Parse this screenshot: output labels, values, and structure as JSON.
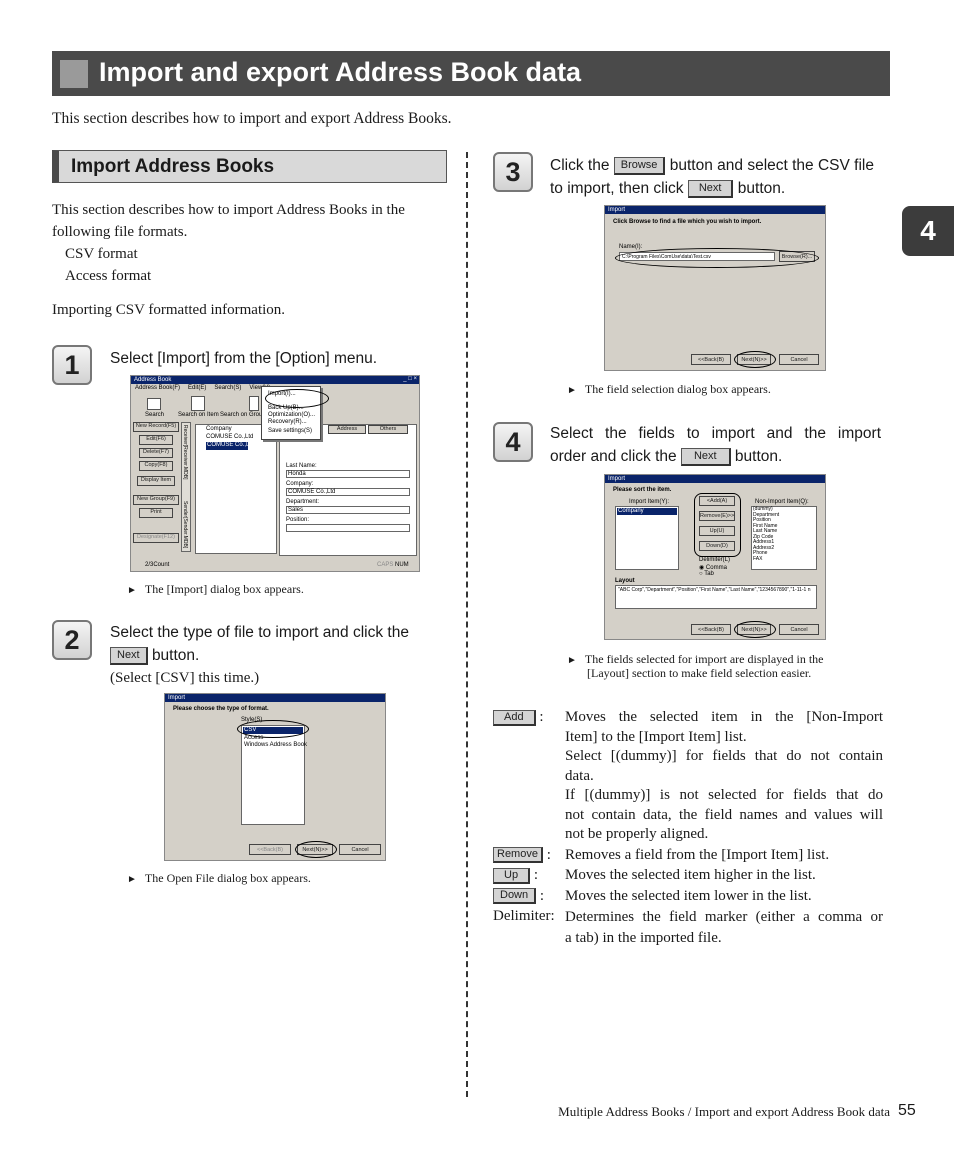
{
  "title": "Import and export Address Book data",
  "intro": "This section describes how to import and export Address Books.",
  "subheading": "Import Address Books",
  "body": {
    "line1": "This section describes how to import Address Books in the",
    "line2": "following file formats.",
    "formats": [
      "CSV format",
      "Access format"
    ],
    "csv_note": "Importing CSV formatted information."
  },
  "steps": [
    {
      "num": "1",
      "text": "Select [Import] from the [Option] menu.",
      "result": "The [Import] dialog box appears."
    },
    {
      "num": "2",
      "text_a": "Select the type of file to import and click the",
      "button": "Next",
      "text_b": "button.",
      "note": "(Select [CSV] this time.)",
      "result": "The Open File dialog box appears."
    },
    {
      "num": "3",
      "text_a": "Click the",
      "button1": "Browse",
      "text_b": "button and select the CSV file",
      "text_c": "to import, then click",
      "button2": "Next",
      "text_d": "button.",
      "result": "The field selection dialog box appears."
    },
    {
      "num": "4",
      "text_a": "Select the fields to import and the import",
      "text_b": "order and click the",
      "button": "Next",
      "text_c": "button.",
      "result_1": "The fields selected for import are displayed in the",
      "result_2": "[Layout] section to make field selection easier."
    }
  ],
  "definitions": [
    {
      "term": "Add",
      "lines": [
        "Moves the selected item in the [Non-Import",
        "Item] to the [Import Item] list.",
        "Select [(dummy)] for fields that do not contain",
        "data.",
        "If [(dummy)] is not selected for fields that do",
        "not contain data, the field names and values will",
        "not be properly aligned."
      ]
    },
    {
      "term": "Remove",
      "lines": [
        "Removes a field from the [Import Item] list."
      ]
    },
    {
      "term": "Up",
      "lines": [
        "Moves the selected item higher in the list."
      ]
    },
    {
      "term": "Down",
      "lines": [
        "Moves the selected item lower in the list."
      ]
    },
    {
      "term": "Delimiter:",
      "lines": [
        "Determines the field marker (either a comma or",
        "a tab) in the imported file."
      ]
    }
  ],
  "chapter_tab": "4",
  "footer": "Multiple Address Books / Import and export Address Book data",
  "page_number": "55",
  "screens": {
    "s1": {
      "title": "Address Book",
      "menu": [
        "Address Book(F)",
        "Edit(E)",
        "Search(S)",
        "View(V)"
      ],
      "toolbar": [
        "Search",
        "Search on Item",
        "Search on Group"
      ],
      "option_menu": [
        "Import(I)...",
        "Back Up(B)...",
        "Optimization(O)...",
        "Recovery(R)...",
        "Save settings(S)"
      ],
      "left_buttons": [
        "New Record(F5)",
        "Edit(F6)",
        "Delete(F7)",
        "Copy(F8)",
        "Display Item",
        "New Group(F9)",
        "Print",
        "Designate(F12)"
      ],
      "rows": [
        "COMUSE Co.,Ltd",
        "COMUSE Co.,Ltd"
      ],
      "col_header": "Company",
      "tabs": [
        "Address",
        "Others"
      ],
      "fields": [
        "Last Name:",
        "Company:",
        "Department:",
        "Position:"
      ],
      "values": [
        "Honda",
        "COMUSE Co.,Ltd",
        "Sales"
      ],
      "status": [
        "2/3Count",
        "CAPS",
        "NUM"
      ],
      "side_tabs": [
        "Receiver[Receiver.MDB]",
        "Sender[Sender.MDB]"
      ]
    },
    "s2": {
      "title": "Import",
      "prompt": "Please choose the type of format.",
      "label": "Style(S)",
      "items": [
        "CSV",
        "Access",
        "Windows Address Book"
      ],
      "buttons": [
        "<<Back(B)",
        "Next(N)>>",
        "Cancel"
      ]
    },
    "s3": {
      "title": "Import",
      "prompt": "Click Browse to find a file which you wish to import.",
      "label": "Name(I):",
      "path": "C:\\Program Files\\ComUse\\data\\Test.csv",
      "browse": "Browse(R)...",
      "buttons": [
        "<<Back(B)",
        "Next(N)>>",
        "Cancel"
      ]
    },
    "s4": {
      "title": "Import",
      "prompt": "Please sort the item.",
      "import_label": "Import Item(Y):",
      "import_items": [
        "Company"
      ],
      "non_import_label": "Non-Import Item(Q):",
      "non_import_items": [
        "(dummy)",
        "Department",
        "Position",
        "First Name",
        "Last Name",
        "Zip Code",
        "Address1",
        "Address2",
        "Phone",
        "FAX"
      ],
      "mid_buttons": [
        "<Add(A)",
        "Remove(E)>>",
        "Up(U)",
        "Down(D)"
      ],
      "delimiter": "Delimiter(L)",
      "radio": [
        "Comma",
        "Tab"
      ],
      "layout_label": "Layout",
      "layout_value": "\"ABC Corp\",\"Department\",\"Position\",\"First Name\",\"Last Name\",\"1234567890\",\"1-11-1 n",
      "buttons": [
        "<<Back(B)",
        "Next(N)>>",
        "Cancel"
      ]
    }
  }
}
